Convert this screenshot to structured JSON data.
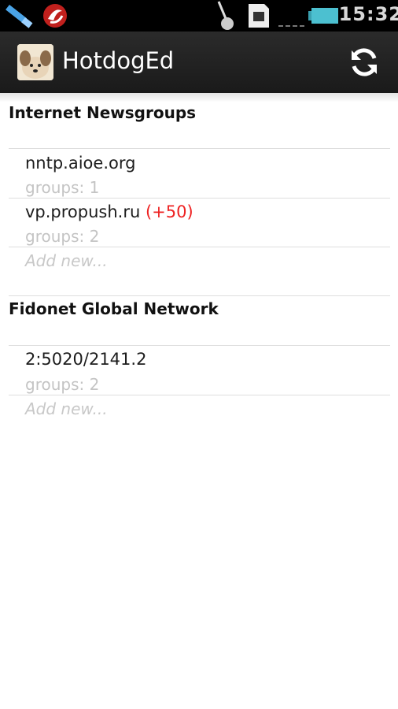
{
  "status_bar": {
    "clock": "15:32",
    "icons": [
      "usb-icon",
      "app-notification-icon",
      "usb-debug-icon",
      "sim-card-icon",
      "signal-icon",
      "battery-icon"
    ]
  },
  "action_bar": {
    "title": "HotdogEd",
    "refresh_icon": "refresh-icon"
  },
  "sections": [
    {
      "title": "Internet Newsgroups",
      "servers": [
        {
          "name": "nntp.aioe.org",
          "badge": "",
          "groups": "groups: 1"
        },
        {
          "name": "vp.propush.ru",
          "badge": "(+50)",
          "groups": "groups: 2"
        }
      ],
      "add_new": "Add new..."
    },
    {
      "title": "Fidonet Global Network",
      "servers": [
        {
          "name": "2:5020/2141.2",
          "badge": "",
          "groups": "groups: 2"
        }
      ],
      "add_new": "Add new..."
    }
  ],
  "colors": {
    "badge": "#ee2222",
    "secondary_text": "#c4c4c4",
    "action_bar": "#222222"
  }
}
